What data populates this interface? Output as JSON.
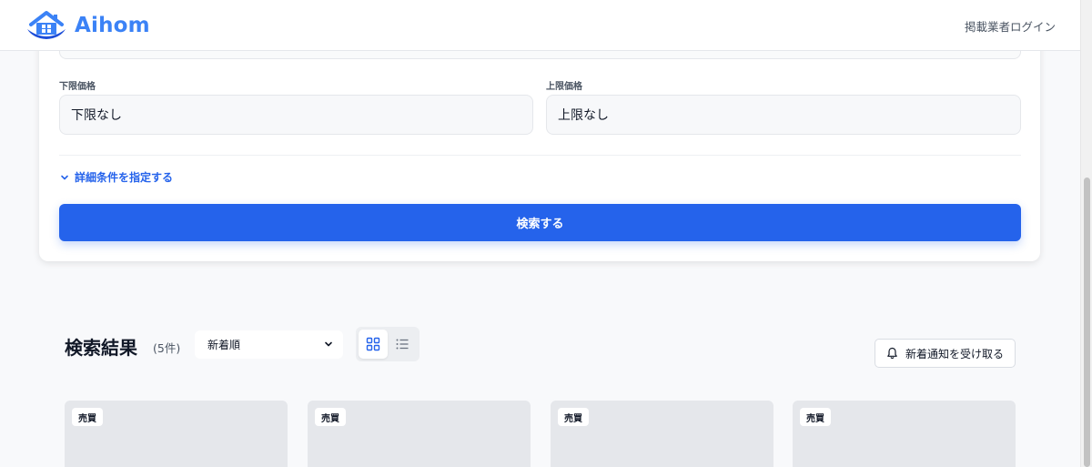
{
  "header": {
    "logo_text": "Aihom",
    "login_link": "掲載業者ログイン"
  },
  "search_form": {
    "min_price": {
      "label": "下限価格",
      "value": "下限なし"
    },
    "max_price": {
      "label": "上限価格",
      "value": "上限なし"
    },
    "details_link": "詳細条件を指定する",
    "search_button": "検索する"
  },
  "results": {
    "title": "検索結果",
    "count": "(5件)",
    "sort_selected": "新着順",
    "view_mode": "grid",
    "notify_button": "新着通知を受け取る",
    "cards": [
      {
        "badge": "売買"
      },
      {
        "badge": "売買"
      },
      {
        "badge": "売買"
      },
      {
        "badge": "売買"
      }
    ]
  },
  "icons": {
    "logo": "house-logo-icon",
    "details": "chevron-down-icon",
    "sort": "chevron-down-icon",
    "grid_view": "grid-icon",
    "list_view": "list-icon",
    "notify": "bell-icon"
  },
  "colors": {
    "accent": "#2563eb",
    "logo": "#3b82f6",
    "card_placeholder": "#e5e7eb"
  }
}
